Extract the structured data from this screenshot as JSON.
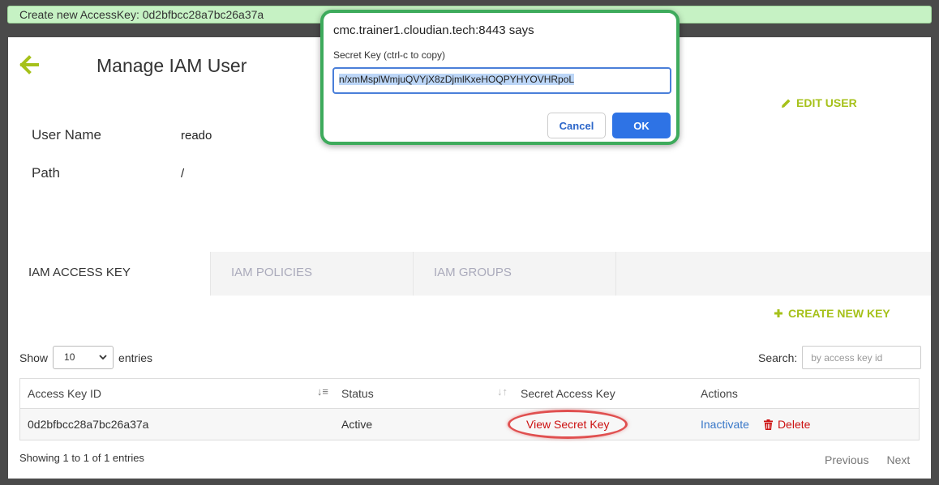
{
  "notification": "Create new AccessKey: 0d2bfbcc28a7bc26a37a",
  "page": {
    "title": "Manage IAM User",
    "edit_user": "EDIT USER",
    "fields": [
      {
        "label": "User Name",
        "value": "reado"
      },
      {
        "label": "Path",
        "value": "/"
      }
    ]
  },
  "tabs": [
    {
      "label": "IAM ACCESS KEY",
      "active": true
    },
    {
      "label": "IAM POLICIES",
      "active": false
    },
    {
      "label": "IAM GROUPS",
      "active": false
    }
  ],
  "create_key": "CREATE NEW KEY",
  "table_controls": {
    "show_label": "Show",
    "show_value": "10",
    "entries_label": "entries",
    "search_label": "Search:",
    "search_placeholder": "by access key id"
  },
  "table": {
    "headers": [
      "Access Key ID",
      "Status",
      "Secret Access Key",
      "Actions"
    ],
    "rows": [
      {
        "access_key_id": "0d2bfbcc28a7bc26a37a",
        "status": "Active",
        "secret": "View Secret Key",
        "action_inactivate": "Inactivate",
        "action_delete": "Delete"
      }
    ]
  },
  "footer": {
    "showing": "Showing 1 to 1 of 1 entries",
    "previous": "Previous",
    "next": "Next"
  },
  "dialog": {
    "title": "cmc.trainer1.cloudian.tech:8443 says",
    "label": "Secret Key (ctrl-c to copy)",
    "value": "n/xmMsplWmjuQVYjX8zDjmlKxeHOQPYHYOVHRpoL",
    "cancel": "Cancel",
    "ok": "OK"
  },
  "colors": {
    "accent_green": "#a6c11a",
    "delete_red": "#cc1111",
    "link_blue": "#3877c8",
    "dialog_border": "#3eab5c",
    "ok_button": "#2e73e5"
  }
}
